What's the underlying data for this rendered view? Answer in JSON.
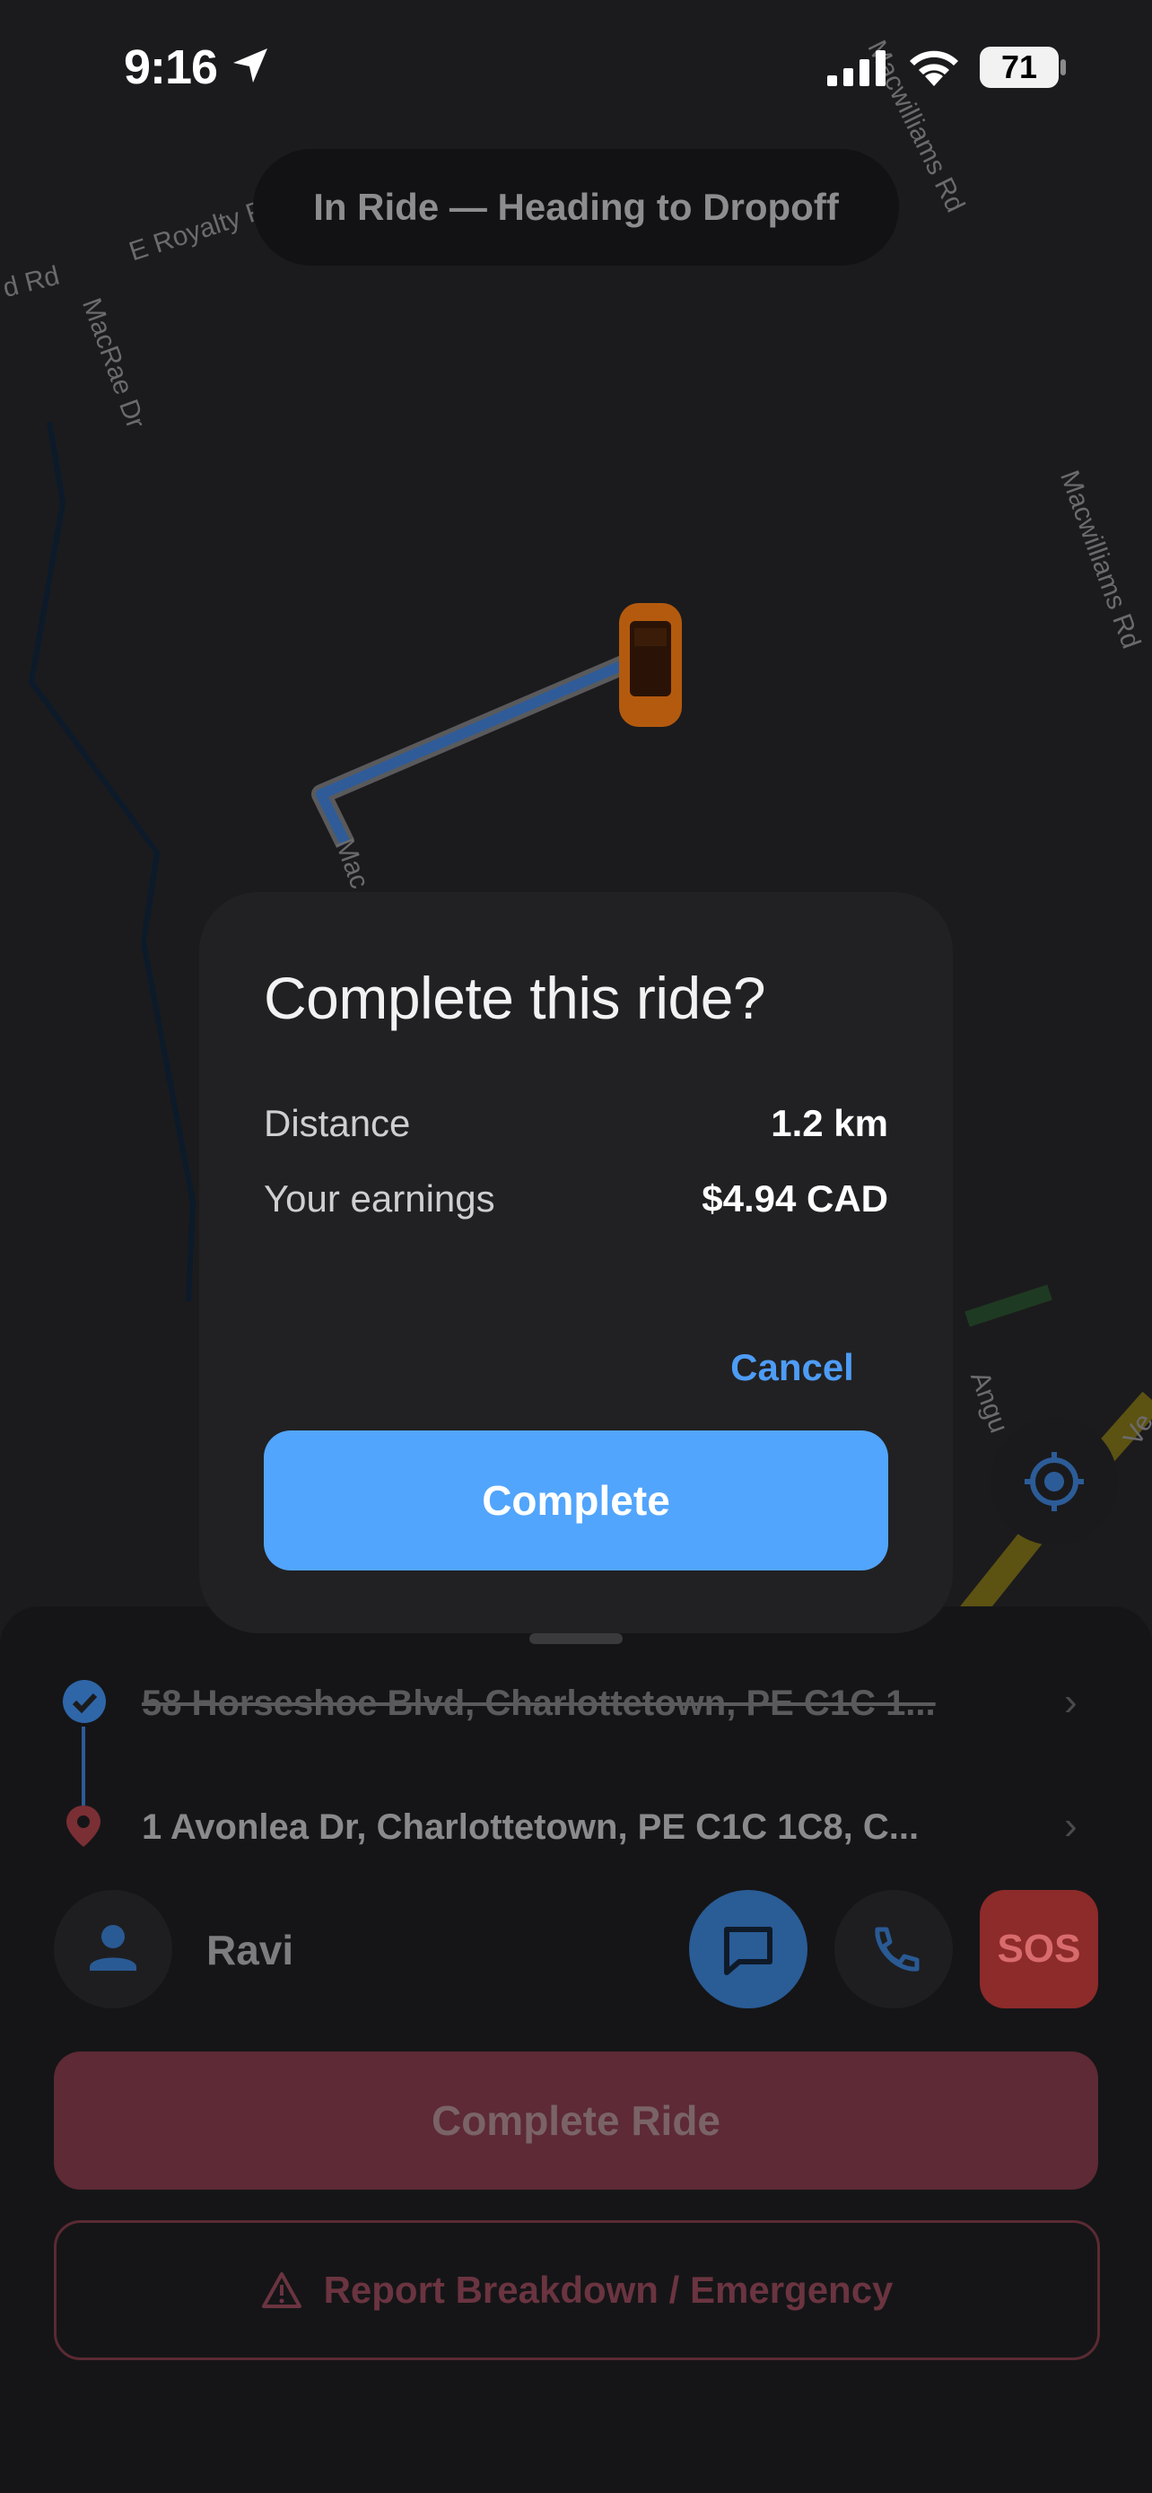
{
  "status_bar": {
    "time": "9:16",
    "battery": "71"
  },
  "ride_status": "In Ride — Heading to Dropoff",
  "map": {
    "streets": [
      "E Royalty Rd",
      "d Rd",
      "MacRae Dr",
      "Macwilliams Rd",
      "Macwilliams Rd",
      "Mac",
      "Angu",
      "Ve"
    ]
  },
  "dialog": {
    "title": "Complete this ride?",
    "distance_label": "Distance",
    "distance_value": "1.2 km",
    "earnings_label": "Your earnings",
    "earnings_value": "$4.94 CAD",
    "cancel_label": "Cancel",
    "complete_label": "Complete"
  },
  "trip": {
    "pickup": "58 Horseshoe Blvd, Charlottetown, PE C1C 1...",
    "dropoff": "1 Avonlea Dr, Charlottetown, PE C1C 1C8, C..."
  },
  "rider": {
    "name": "Ravi"
  },
  "actions": {
    "sos_label": "SOS",
    "complete_ride_label": "Complete Ride",
    "report_label": "Report Breakdown / Emergency"
  },
  "colors": {
    "accent_blue": "#52a5fc",
    "danger_red": "#8d2a2a",
    "route_blue": "#3f7fd0",
    "car_orange": "#c1620e"
  }
}
